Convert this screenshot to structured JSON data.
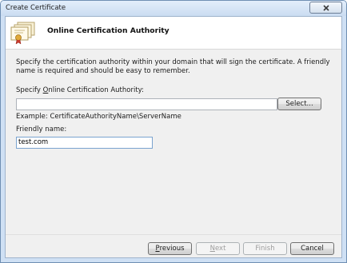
{
  "window": {
    "title": "Create Certificate",
    "close_icon": "close-icon"
  },
  "header": {
    "title": "Online Certification Authority",
    "icon": "certificate-icon"
  },
  "body": {
    "description": "Specify the certification authority within your domain that will sign the certificate. A friendly name is required and should be easy to remember.",
    "ca_label_prefix": "Specify ",
    "ca_label_access": "O",
    "ca_label_rest": "nline Certification Authority:",
    "ca_value": "",
    "select_label": "Select...",
    "example": "Example: CertificateAuthorityName\\ServerName",
    "friendly_label": "Friendly name:",
    "friendly_value": "test.com"
  },
  "footer": {
    "previous_access": "P",
    "previous_rest": "revious",
    "next_access": "N",
    "next_rest": "ext",
    "finish_label": "Finish",
    "cancel_label": "Cancel"
  },
  "colors": {
    "frame": "#cfe0f4",
    "dialog_background": "#f0f0f0",
    "header_background": "#ffffff"
  }
}
